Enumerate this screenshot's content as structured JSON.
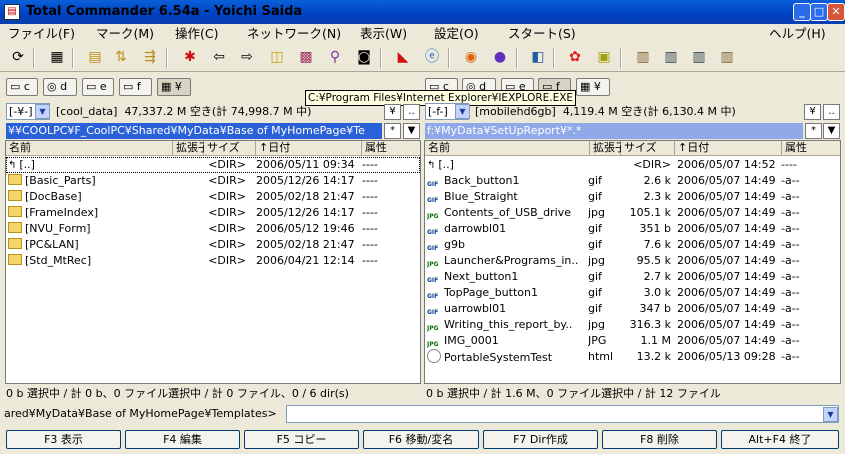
{
  "window": {
    "title": "Total Commander 6.54a - Yoichi Saida",
    "minimize": "_",
    "maximize": "□",
    "close": "✕"
  },
  "menu": [
    "ファイル(F)",
    "マーク(M)",
    "操作(C)",
    "ネットワーク(N)",
    "表示(W)",
    "設定(O)",
    "スタート(S)",
    "ヘルプ(H)"
  ],
  "toolbar_icons": [
    "refresh-icon",
    "brief-view-icon",
    "full-view-icon",
    "tree-icon",
    "sort-icon",
    "invert-selection-icon",
    "back-icon",
    "forward-icon",
    "pack-icon",
    "unpack-icon",
    "find-icon",
    "ftp-icon",
    "multi-rename-icon",
    "acrobat-icon",
    "internet-explorer-icon",
    "firefox-icon",
    "media-icon",
    "notepad-icon",
    "flower-icon",
    "image-icon",
    "file-cabinet-1-icon",
    "file-cabinet-2-icon",
    "file-cabinet-3-icon",
    "file-cabinet-4-icon"
  ],
  "tooltip": "C:¥Program Files¥Internet Explorer¥IEXPLORE.EXE",
  "left": {
    "drives": [
      "c",
      "d",
      "e",
      "f",
      "¥"
    ],
    "drive_combo": "[-¥-]",
    "volume": "[cool_data]",
    "free_space": "47,337.2 M 空き(計 74,998.7 M 中)",
    "root_btn": "¥",
    "up_btn": "..",
    "path": "¥¥COOLPC¥F_CoolPC¥Shared¥MyData¥Base of MyHomePage¥Te",
    "filter_btn": "*",
    "hist_btn": "▼",
    "headers": {
      "name": "名前",
      "ext": "拡張子",
      "size": "サイズ",
      "date": "↑日付",
      "attr": "属性"
    },
    "files": [
      {
        "name": "[..]",
        "ext": "",
        "size": "<DIR>",
        "date": "2006/05/11 09:34",
        "attr": "----",
        "type": "up"
      },
      {
        "name": "[Basic_Parts]",
        "ext": "",
        "size": "<DIR>",
        "date": "2005/12/26 14:17",
        "attr": "----",
        "type": "dir"
      },
      {
        "name": "[DocBase]",
        "ext": "",
        "size": "<DIR>",
        "date": "2005/02/18 21:47",
        "attr": "----",
        "type": "dir"
      },
      {
        "name": "[FrameIndex]",
        "ext": "",
        "size": "<DIR>",
        "date": "2005/12/26 14:17",
        "attr": "----",
        "type": "dir"
      },
      {
        "name": "[NVU_Form]",
        "ext": "",
        "size": "<DIR>",
        "date": "2006/05/12 19:46",
        "attr": "----",
        "type": "dir"
      },
      {
        "name": "[PC&LAN]",
        "ext": "",
        "size": "<DIR>",
        "date": "2005/02/18 21:47",
        "attr": "----",
        "type": "dir"
      },
      {
        "name": "[Std_MtRec]",
        "ext": "",
        "size": "<DIR>",
        "date": "2006/04/21 12:14",
        "attr": "----",
        "type": "dir"
      }
    ],
    "status": "0 b 選択中 / 計 0 b、0 ファイル選択中 / 計 0 ファイル、0 / 6 dir(s)"
  },
  "right": {
    "drives": [
      "c",
      "d",
      "e",
      "f",
      "¥"
    ],
    "drive_combo": "[-f-]",
    "volume": "[mobilehd6gb]",
    "free_space": "4,119.4 M 空き(計 6,130.4 M 中)",
    "root_btn": "¥",
    "up_btn": "..",
    "path": "f:¥MyData¥SetUpReport¥*.*",
    "filter_btn": "*",
    "hist_btn": "▼",
    "headers": {
      "name": "名前",
      "ext": "拡張子",
      "size": "サイズ",
      "date": "↑日付",
      "attr": "属性"
    },
    "files": [
      {
        "name": "[..]",
        "ext": "",
        "size": "<DIR>",
        "date": "2006/05/07 14:52",
        "attr": "----",
        "type": "up"
      },
      {
        "name": "Back_button1",
        "ext": "gif",
        "size": "2.6 k",
        "date": "2006/05/07 14:49",
        "attr": "-a--",
        "type": "gif"
      },
      {
        "name": "Blue_Straight",
        "ext": "gif",
        "size": "2.3 k",
        "date": "2006/05/07 14:49",
        "attr": "-a--",
        "type": "gif"
      },
      {
        "name": "Contents_of_USB_drive",
        "ext": "jpg",
        "size": "105.1 k",
        "date": "2006/05/07 14:49",
        "attr": "-a--",
        "type": "jpg"
      },
      {
        "name": "darrowbl01",
        "ext": "gif",
        "size": "351 b",
        "date": "2006/05/07 14:49",
        "attr": "-a--",
        "type": "gif"
      },
      {
        "name": "g9b",
        "ext": "gif",
        "size": "7.6 k",
        "date": "2006/05/07 14:49",
        "attr": "-a--",
        "type": "gif"
      },
      {
        "name": "Launcher&Programs_in..",
        "ext": "jpg",
        "size": "95.5 k",
        "date": "2006/05/07 14:49",
        "attr": "-a--",
        "type": "jpg"
      },
      {
        "name": "Next_button1",
        "ext": "gif",
        "size": "2.7 k",
        "date": "2006/05/07 14:49",
        "attr": "-a--",
        "type": "gif"
      },
      {
        "name": "TopPage_button1",
        "ext": "gif",
        "size": "3.0 k",
        "date": "2006/05/07 14:49",
        "attr": "-a--",
        "type": "gif"
      },
      {
        "name": "uarrowbl01",
        "ext": "gif",
        "size": "347 b",
        "date": "2006/05/07 14:49",
        "attr": "-a--",
        "type": "gif"
      },
      {
        "name": "Writing_this_report_by..",
        "ext": "jpg",
        "size": "316.3 k",
        "date": "2006/05/07 14:49",
        "attr": "-a--",
        "type": "jpg"
      },
      {
        "name": "IMG_0001",
        "ext": "JPG",
        "size": "1.1 M",
        "date": "2006/05/07 14:49",
        "attr": "-a--",
        "type": "jpg"
      },
      {
        "name": "PortableSystemTest",
        "ext": "html",
        "size": "13.2 k",
        "date": "2006/05/13 09:28",
        "attr": "-a--",
        "type": "htm"
      }
    ],
    "status": "0 b 選択中 / 計 1.6 M、0 ファイル選択中 / 計 12 ファイル"
  },
  "command": {
    "prompt": "ared¥MyData¥Base of MyHomePage¥Templates>",
    "value": ""
  },
  "fkeys": [
    "F3 表示",
    "F4 編集",
    "F5 コピー",
    "F6 移動/変名",
    "F7 Dir作成",
    "F8 削除",
    "Alt+F4 終了"
  ]
}
